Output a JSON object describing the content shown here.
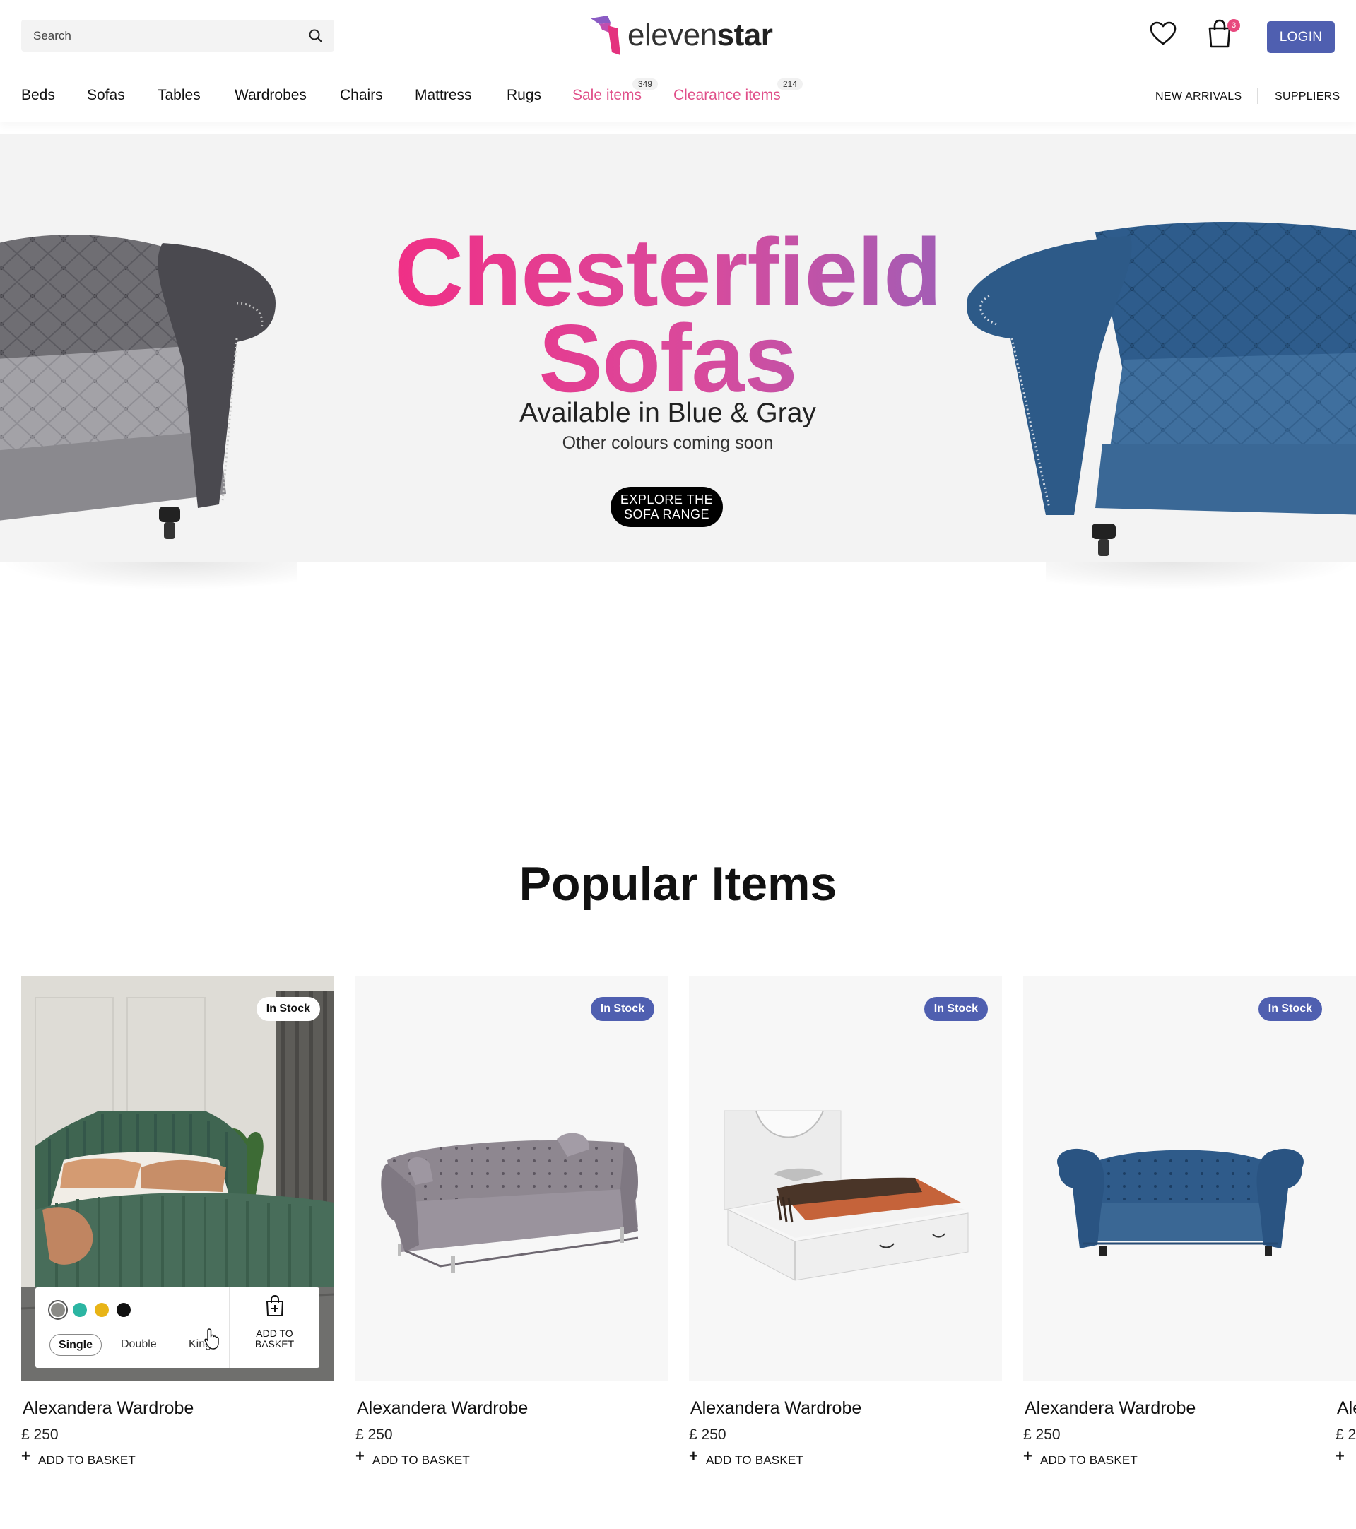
{
  "header": {
    "search_placeholder": "Search",
    "logo_light": "eleven",
    "logo_bold": "star",
    "cart_count": "3",
    "login_label": "LOGIN"
  },
  "nav": {
    "items": [
      "Beds",
      "Sofas",
      "Tables",
      "Wardrobes",
      "Chairs",
      "Mattress",
      "Rugs"
    ],
    "sale": {
      "label": "Sale items",
      "count": "349"
    },
    "clearance": {
      "label": "Clearance items",
      "count": "214"
    },
    "right": [
      "NEW ARRIVALS",
      "SUPPLIERS"
    ]
  },
  "hero": {
    "title_line1": "Chesterfield",
    "title_line2": "Sofas",
    "subtitle": "Available in Blue & Gray",
    "note": "Other colours coming soon",
    "button_line1": "EXPLORE THE",
    "button_line2": "SOFA RANGE"
  },
  "popular": {
    "title": "Popular Items",
    "cards": [
      {
        "name": "Alexandera Wardrobe",
        "price": "£ 250",
        "badge": "In Stock",
        "add_label": "ADD TO BASKET"
      },
      {
        "name": "Alexandera Wardrobe",
        "price": "£ 250",
        "badge": "In Stock",
        "add_label": "ADD TO BASKET"
      },
      {
        "name": "Alexandera Wardrobe",
        "price": "£ 250",
        "badge": "In Stock",
        "add_label": "ADD TO BASKET"
      },
      {
        "name": "Alexandera Wardrobe",
        "price": "£ 250",
        "badge": "In Stock",
        "add_label": "ADD TO BASKET"
      },
      {
        "name": "Ale",
        "price": "£ 2",
        "add_label": ""
      }
    ],
    "quick_add": {
      "swatches": [
        "#8a8a86",
        "#2bb5a2",
        "#e8b417",
        "#111111"
      ],
      "sizes": [
        "Single",
        "Double",
        "King"
      ],
      "selected_size": "Single",
      "add_line1": "ADD TO",
      "add_line2": "BASKET"
    }
  },
  "colors": {
    "accent": "#4f5fb0",
    "pink": "#e0508a",
    "gradient_start": "#f22d84",
    "gradient_end": "#9d5fb8"
  }
}
